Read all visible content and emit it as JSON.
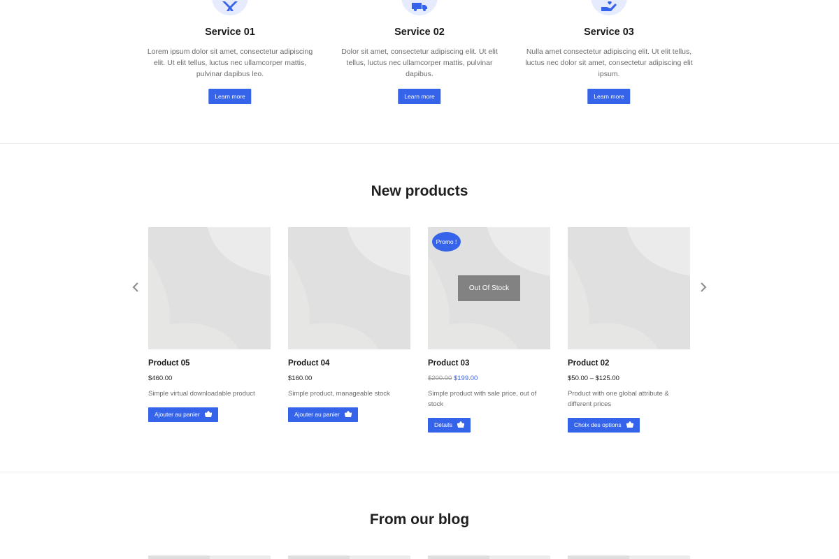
{
  "services": [
    {
      "icon": "tools-icon",
      "title": "Service 01",
      "text": "Lorem ipsum dolor sit amet, consectetur adipiscing elit. Ut elit tellus, luctus nec ullamcorper mattis, pulvinar dapibus leo.",
      "button": "Learn more"
    },
    {
      "icon": "delivery-truck-icon",
      "title": "Service 02",
      "text": "Dolor sit amet, consectetur adipiscing elit. Ut elit tellus, luctus nec ullamcorper mattis, pulvinar dapibus.",
      "button": "Learn more"
    },
    {
      "icon": "hand-heart-icon",
      "title": "Service 03",
      "text": "Nulla amet consectetur adipiscing elit. Ut elit tellus, luctus nec dolor sit amet, consectetur adipiscing elit ipsum.",
      "button": "Learn more"
    }
  ],
  "products": {
    "title": "New products",
    "items": [
      {
        "name": "Product 05",
        "price": "$460.00",
        "description": "Simple virtual downloadable product",
        "button": "Ajouter au panier"
      },
      {
        "name": "Product 04",
        "price": "$160.00",
        "description": "Simple product, manageable stock",
        "button": "Ajouter au panier"
      },
      {
        "name": "Product 03",
        "price_old": "$200.00",
        "price_new": "$199.00",
        "badge": "Promo !",
        "overlay": "Out Of Stock",
        "description": "Simple product with sale price, out of stock",
        "button": "Détails"
      },
      {
        "name": "Product 02",
        "price": "$50.00 – $125.00",
        "description": "Product with one global attribute & different prices",
        "button": "Choix des options"
      }
    ]
  },
  "blog": {
    "title": "From our blog"
  },
  "colors": {
    "accent": "#3563e9",
    "icon_circle": "#e6ecfd",
    "placeholder": "#dfe0df",
    "out_of_stock": "#828282"
  }
}
